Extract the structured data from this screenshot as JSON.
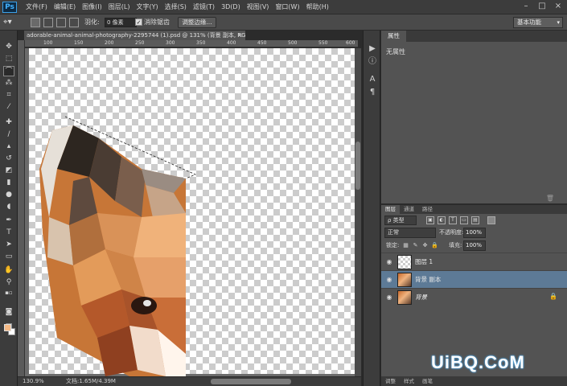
{
  "app": {
    "logo": "Ps"
  },
  "menu": [
    "文件(F)",
    "编辑(E)",
    "图像(I)",
    "图层(L)",
    "文字(Y)",
    "选择(S)",
    "滤镜(T)",
    "3D(D)",
    "视图(V)",
    "窗口(W)",
    "帮助(H)"
  ],
  "window_controls": {
    "minimize": "–",
    "maximize": "□",
    "close": "×"
  },
  "options": {
    "feather_label": "羽化:",
    "feather_value": "0 像素",
    "antialias_label": "消除锯齿",
    "refine_edge_label": "调整边缘...",
    "workspace": "基本功能"
  },
  "document": {
    "tab_title": "adorable-animal-animal-photography-2295744 (1).psd @ 131% (背景 副本, RGB/8) *",
    "close": "×",
    "zoom": "130.9%",
    "doc_size": "文档:1.65M/4.39M"
  },
  "ruler": {
    "top_ticks": [
      "100",
      "150",
      "200",
      "250",
      "300",
      "350",
      "400",
      "450",
      "500",
      "550",
      "600"
    ]
  },
  "properties": {
    "tab": "属性",
    "empty_text": "无属性"
  },
  "layers": {
    "tabs": [
      "图层",
      "通道",
      "路径"
    ],
    "filter": "ρ 类型",
    "blend_mode": "正常",
    "opacity_label": "不透明度:",
    "opacity": "100%",
    "lock_label": "锁定:",
    "fill_label": "填充:",
    "fill": "100%",
    "items": [
      {
        "name": "图层 1",
        "selected": false,
        "thumb": "checker"
      },
      {
        "name": "背景 副本",
        "selected": true,
        "thumb": "fox"
      },
      {
        "name": "背景",
        "selected": false,
        "thumb": "fox",
        "italic": true,
        "locked": true
      }
    ],
    "bottom_tabs": [
      "调整",
      "样式",
      "画笔"
    ]
  },
  "watermark": {
    "text": "UiBQ.CoM"
  },
  "colors": {
    "foreground": "#f5b985",
    "background": "#ffffff",
    "selected_layer": "#5d7a96",
    "ps_blue": "#43b2ff"
  }
}
